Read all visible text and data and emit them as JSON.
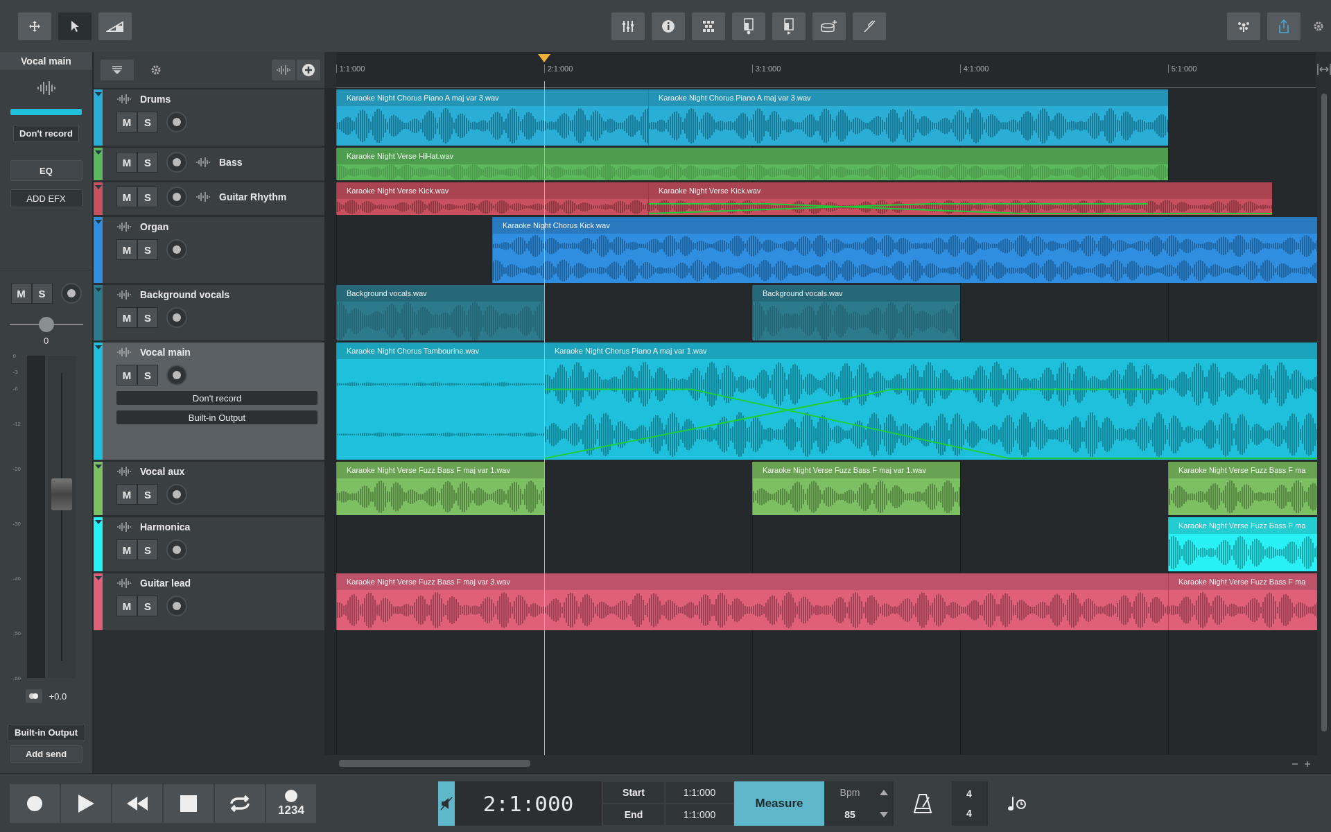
{
  "toolbar": {
    "left_tools": [
      {
        "selected": false
      },
      {
        "selected": true
      },
      {
        "selected": false
      }
    ]
  },
  "channel_strip": {
    "title": "Vocal main",
    "input": "Don't record",
    "eq": "EQ",
    "add_efx": "ADD EFX",
    "mute": "M",
    "solo": "S",
    "pan": {
      "level": 0.5
    },
    "pan_reading": "0",
    "meter_scale": [
      "0",
      "-3",
      "-6",
      "-12",
      "-20",
      "-30",
      "-40",
      "-50",
      "-60"
    ],
    "fader": {
      "level": 0.57
    },
    "gain": "+0.0",
    "output": "Built-in Output",
    "add_send": "Add send"
  },
  "ruler": [
    "1:1:000",
    "2:1:000",
    "3:1:000",
    "4:1:000",
    "5:1:000"
  ],
  "tracks": [
    {
      "name": "Drums",
      "kind": "stacked",
      "color": "#2aaed6",
      "selected": false,
      "mute": "M",
      "solo": "S",
      "clips": [
        {
          "label": "Karaoke Night Chorus Piano A maj var 3.wav",
          "automation": false
        },
        {
          "label": "Karaoke Night Chorus Piano A maj var 3.wav",
          "automation": false
        }
      ]
    },
    {
      "name": "Bass",
      "kind": "inline",
      "color": "#5cb85c",
      "selected": false,
      "mute": "M",
      "solo": "S",
      "clips": [
        {
          "label": "Karaoke Night Verse HiHat.wav",
          "automation": false
        }
      ]
    },
    {
      "name": "Guitar Rhythm",
      "kind": "inline",
      "color": "#c9505f",
      "selected": false,
      "mute": "M",
      "solo": "S",
      "clips": [
        {
          "label": "Karaoke Night Verse Kick.wav",
          "automation": false
        },
        {
          "label": "Karaoke Night Verse Kick.wav",
          "automation": true
        }
      ]
    },
    {
      "name": "Organ",
      "kind": "stacked",
      "color": "#2f8ee0",
      "selected": false,
      "mute": "M",
      "solo": "S",
      "clips": [
        {
          "label": "Karaoke Night Chorus Kick.wav",
          "automation": false
        }
      ]
    },
    {
      "name": "Background vocals",
      "kind": "stacked",
      "color": "#2d7a8c",
      "selected": false,
      "mute": "M",
      "solo": "S",
      "clips": [
        {
          "label": "Background vocals.wav",
          "automation": false
        },
        {
          "label": "Background vocals.wav",
          "automation": false
        }
      ]
    },
    {
      "name": "Vocal main",
      "kind": "stacked",
      "color": "#1fc0db",
      "selected": true,
      "mute": "M",
      "solo": "S",
      "input": "Don't record",
      "output": "Built-in Output",
      "clips": [
        {
          "label": "Karaoke Night Chorus Tambourine.wav",
          "automation": false
        },
        {
          "label": "Karaoke Night Chorus Piano A maj var 1.wav",
          "automation": true
        }
      ]
    },
    {
      "name": "Vocal aux",
      "kind": "stacked",
      "color": "#7dbf63",
      "selected": false,
      "mute": "M",
      "solo": "S",
      "clips": [
        {
          "label": "Karaoke Night Verse Fuzz Bass F maj var 1.wav",
          "automation": false
        },
        {
          "label": "Karaoke Night Verse Fuzz Bass F maj var 1.wav",
          "automation": false
        },
        {
          "label": "Karaoke Night Verse Fuzz Bass F ma",
          "automation": false
        }
      ]
    },
    {
      "name": "Harmonica",
      "kind": "stacked",
      "color": "#29f0f5",
      "selected": false,
      "mute": "M",
      "solo": "S",
      "clips": [
        {
          "label": "Karaoke Night Verse Fuzz Bass F ma",
          "automation": false
        }
      ]
    },
    {
      "name": "Guitar lead",
      "kind": "stacked",
      "color": "#e0607a",
      "selected": false,
      "mute": "M",
      "solo": "S",
      "clips": [
        {
          "label": "Karaoke Night Verse Fuzz Bass F maj var 3.wav",
          "automation": false
        },
        {
          "label": "Karaoke Night Verse Fuzz Bass F ma",
          "automation": false
        }
      ]
    }
  ],
  "transport": {
    "count_in": "1234",
    "time": "2:1:000",
    "start_label": "Start",
    "start": "1:1:000",
    "end_label": "End",
    "end": "1:1:000",
    "mode": "Measure",
    "mode_selected": true,
    "bpm_label": "Bpm",
    "bpm": "85",
    "time_signature": [
      "4",
      "4"
    ]
  }
}
